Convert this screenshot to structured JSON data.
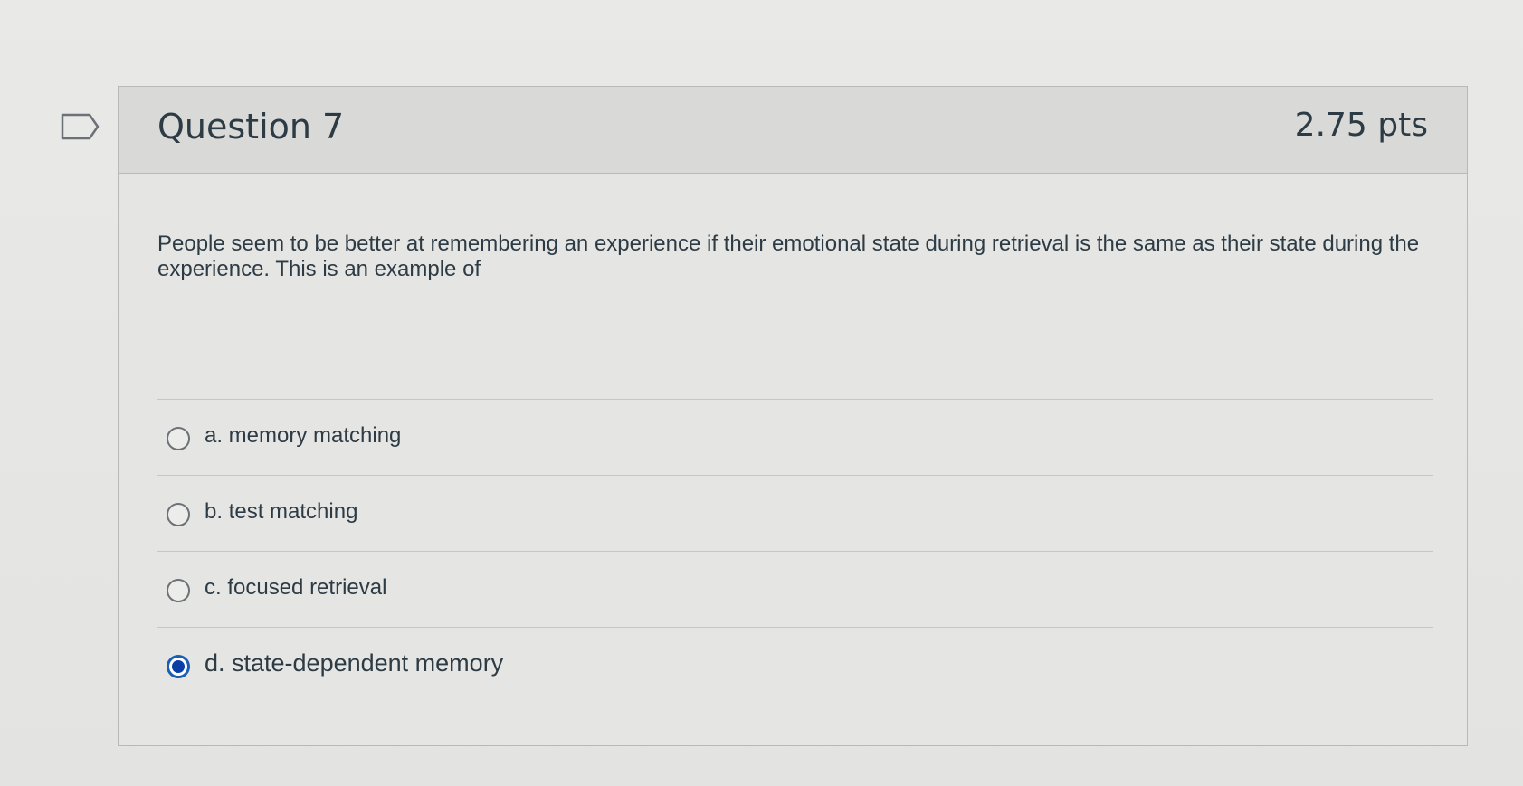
{
  "question": {
    "title": "Question 7",
    "points": "2.75 pts",
    "text": "People seem to be better at remembering an experience if their emotional state during retrieval is the same as their state during the experience. This is an example of",
    "flag_icon": "flag-outline-icon"
  },
  "answers": [
    {
      "label": "a. memory matching",
      "selected": false
    },
    {
      "label": "b. test matching",
      "selected": false
    },
    {
      "label": "c. focused retrieval",
      "selected": false
    },
    {
      "label": "d. state-dependent memory",
      "selected": true
    }
  ],
  "colors": {
    "text": "#2d3b45",
    "selected_radio": "#0b3fa6",
    "header_bg": "#d9d9d7"
  }
}
